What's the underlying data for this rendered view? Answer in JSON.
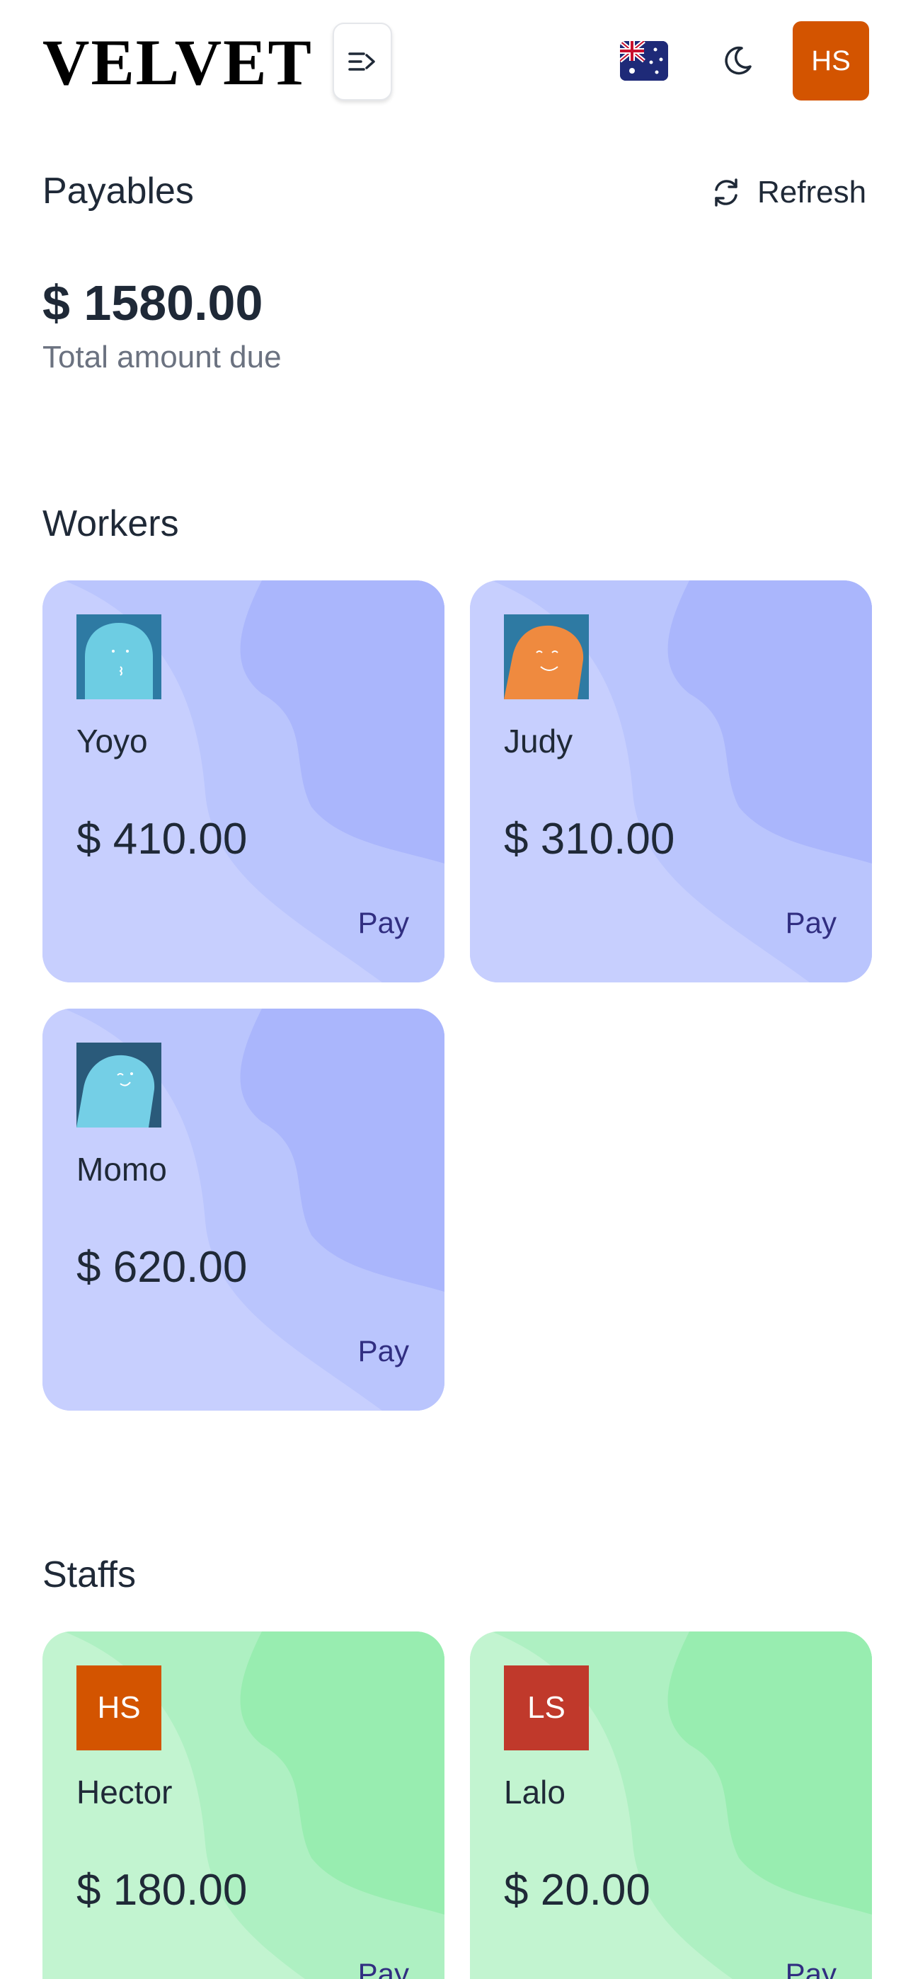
{
  "header": {
    "logo": "VELVET",
    "avatar_initials": "HS",
    "avatar_color": "#d35400"
  },
  "payables": {
    "title": "Payables",
    "refresh_label": "Refresh",
    "total_amount": "$ 1580.00",
    "total_label": "Total amount due"
  },
  "workers": {
    "title": "Workers",
    "items": [
      {
        "name": "Yoyo",
        "amount": "$ 410.00",
        "pay_label": "Pay"
      },
      {
        "name": "Judy",
        "amount": "$ 310.00",
        "pay_label": "Pay"
      },
      {
        "name": "Momo",
        "amount": "$ 620.00",
        "pay_label": "Pay"
      }
    ]
  },
  "staffs": {
    "title": "Staffs",
    "items": [
      {
        "name": "Hector",
        "initials": "HS",
        "avatar_color": "#d35400",
        "amount": "$ 180.00",
        "pay_label": "Pay"
      },
      {
        "name": "Lalo",
        "initials": "LS",
        "avatar_color": "#c0392b",
        "amount": "$ 20.00",
        "pay_label": "Pay"
      }
    ]
  },
  "icons": {
    "menu": "menu-icon",
    "flag": "australia-flag-icon",
    "theme": "moon-icon",
    "refresh": "refresh-icon"
  },
  "colors": {
    "worker_card": "#c7cffe",
    "staff_card": "#c2f4d0",
    "pay_link": "#312e81"
  }
}
